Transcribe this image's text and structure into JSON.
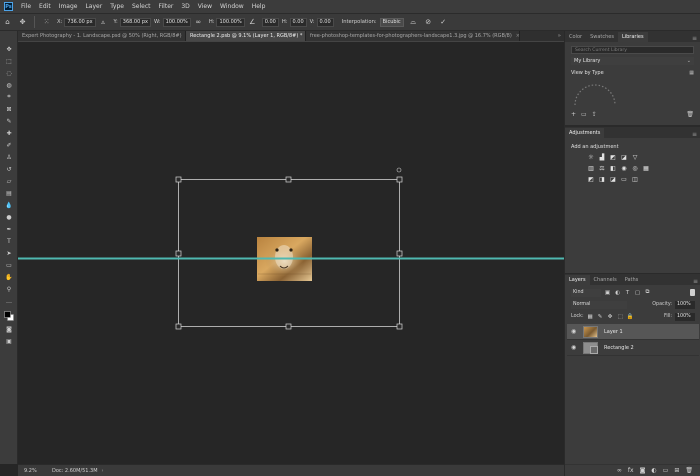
{
  "app": {
    "logo_text": "Ps"
  },
  "menu": [
    "File",
    "Edit",
    "Image",
    "Layer",
    "Type",
    "Select",
    "Filter",
    "3D",
    "View",
    "Window",
    "Help"
  ],
  "options": {
    "x_label": "X:",
    "x_value": "736.00 px",
    "y_label": "Y:",
    "y_value": "368.00 px",
    "w_label": "W:",
    "w_value": "100.00%",
    "h_label": "H:",
    "h_value": "100.00%",
    "angle_value": "0.00",
    "h_skew_label": "H:",
    "h_skew_value": "0.00",
    "v_skew_label": "V:",
    "v_skew_value": "0.00",
    "interpolation_label": "Interpolation:",
    "interpolation_value": "Bicubic"
  },
  "doc_tabs": [
    {
      "label": "Expert Photography - 1. Landscape.psd @ 50% (Right, RGB/8#)",
      "active": false
    },
    {
      "label": "Rectangle 2.psb @ 9.1% (Layer 1, RGB/8#) *",
      "active": true
    },
    {
      "label": "free-photoshop-templates-for-photographers-landscape1.3.jpg @ 16.7% (RGB/8)",
      "active": false
    }
  ],
  "status": {
    "zoom": "9.2%",
    "doc": "Doc: 2.60M/51.3M"
  },
  "libraries_panel": {
    "tabs": [
      "Color",
      "Swatches",
      "Libraries"
    ],
    "active_tab": "Libraries",
    "search_placeholder": "Search Current Library",
    "library": "My Library",
    "view_by": "View by Type"
  },
  "adjustments_panel": {
    "tab": "Adjustments",
    "title": "Add an adjustment"
  },
  "layers_panel": {
    "tabs": [
      "Layers",
      "Channels",
      "Paths"
    ],
    "active_tab": "Layers",
    "kind": "Kind",
    "blend_mode": "Normal",
    "opacity_label": "Opacity:",
    "opacity_value": "100%",
    "lock_label": "Lock:",
    "fill_label": "Fill:",
    "fill_value": "100%",
    "layers": [
      {
        "name": "Layer 1",
        "selected": true
      },
      {
        "name": "Rectangle 2",
        "selected": false
      }
    ]
  },
  "colors": {
    "guide": "#4fb8b0",
    "canvas_bg": "#262626",
    "panel_bg": "#3c3c3c"
  }
}
